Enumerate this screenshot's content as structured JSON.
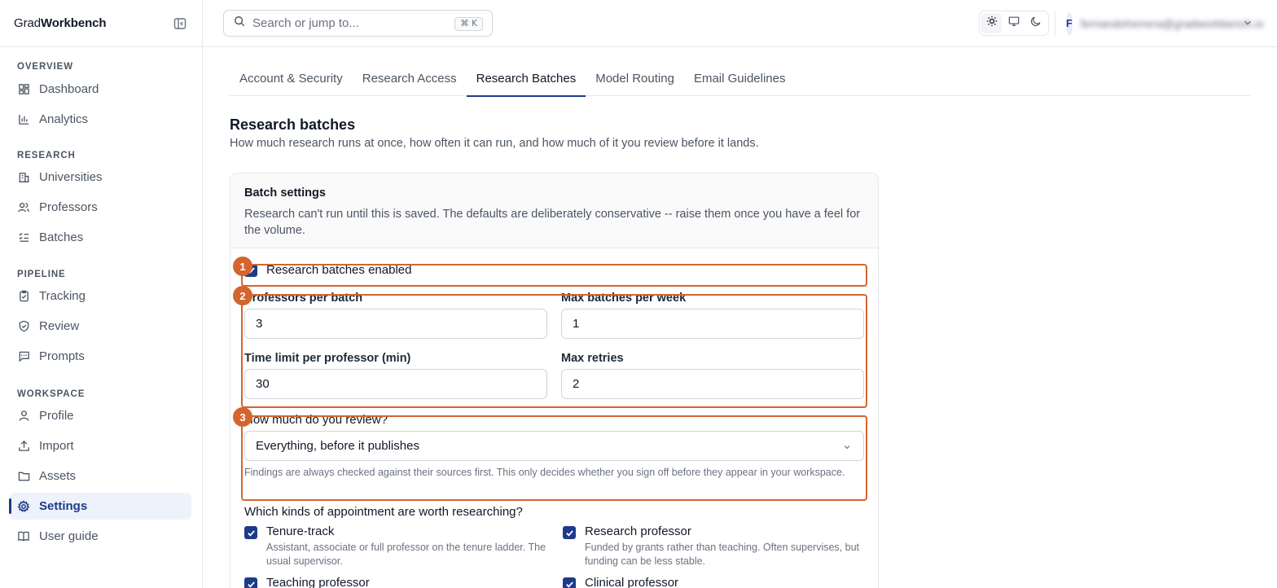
{
  "brand": {
    "prefix": "Grad",
    "suffix": "Workbench"
  },
  "search": {
    "placeholder": "Search or jump to...",
    "shortcut": "⌘ K"
  },
  "user": {
    "initial": "F",
    "name": "fernandoherrera@gradworkbench.io"
  },
  "sidebar": {
    "sections": [
      {
        "title": "OVERVIEW",
        "items": [
          {
            "label": "Dashboard",
            "icon": "dashboard-icon"
          },
          {
            "label": "Analytics",
            "icon": "bar-chart-icon"
          }
        ]
      },
      {
        "title": "RESEARCH",
        "items": [
          {
            "label": "Universities",
            "icon": "building-icon"
          },
          {
            "label": "Professors",
            "icon": "users-icon"
          },
          {
            "label": "Batches",
            "icon": "list-checks-icon"
          }
        ]
      },
      {
        "title": "PIPELINE",
        "items": [
          {
            "label": "Tracking",
            "icon": "clipboard-icon"
          },
          {
            "label": "Review",
            "icon": "shield-check-icon"
          },
          {
            "label": "Prompts",
            "icon": "message-icon"
          }
        ]
      },
      {
        "title": "WORKSPACE",
        "items": [
          {
            "label": "Profile",
            "icon": "user-icon"
          },
          {
            "label": "Import",
            "icon": "upload-icon"
          },
          {
            "label": "Assets",
            "icon": "folder-icon"
          },
          {
            "label": "Settings",
            "icon": "gear-icon",
            "active": true
          },
          {
            "label": "User guide",
            "icon": "book-icon"
          }
        ]
      }
    ]
  },
  "tabs": [
    {
      "label": "Account & Security"
    },
    {
      "label": "Research Access"
    },
    {
      "label": "Research Batches",
      "active": true
    },
    {
      "label": "Model Routing"
    },
    {
      "label": "Email Guidelines"
    }
  ],
  "page": {
    "title": "Research batches",
    "subtitle": "How much research runs at once, how often it can run, and how much of it you review before it lands."
  },
  "card": {
    "title": "Batch settings",
    "description": "Research can't run until this is saved. The defaults are deliberately conservative -- raise them once you have a feel for the volume.",
    "enabled_label": "Research batches enabled",
    "enabled": true,
    "fields": {
      "professors_per_batch": {
        "label": "Professors per batch",
        "value": "3"
      },
      "max_batches_per_week": {
        "label": "Max batches per week",
        "value": "1"
      },
      "time_limit": {
        "label": "Time limit per professor (min)",
        "value": "30"
      },
      "max_retries": {
        "label": "Max retries",
        "value": "2"
      }
    },
    "review": {
      "label": "How much do you review?",
      "selected": "Everything, before it publishes",
      "hint": "Findings are always checked against their sources first. This only decides whether you sign off before they appear in your workspace."
    },
    "appointments": {
      "title": "Which kinds of appointment are worth researching?",
      "items": [
        {
          "name": "Tenure-track",
          "desc": "Assistant, associate or full professor on the tenure ladder. The usual supervisor.",
          "checked": true
        },
        {
          "name": "Research professor",
          "desc": "Funded by grants rather than teaching. Often supervises, but funding can be less stable.",
          "checked": true
        },
        {
          "name": "Teaching professor",
          "desc": "",
          "checked": true
        },
        {
          "name": "Clinical professor",
          "desc": "",
          "checked": true
        }
      ]
    }
  },
  "annotations": {
    "badges": [
      "1",
      "2",
      "3"
    ],
    "color": "#d5652f"
  },
  "colors": {
    "accent": "#1e3a8a",
    "active_bg": "#eef2fb",
    "annotation": "#d5652f"
  }
}
